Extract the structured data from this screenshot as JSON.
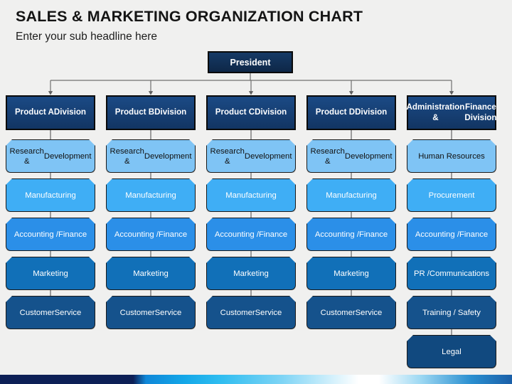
{
  "header": {
    "title": "SALES & MARKETING ORGANIZATION CHART",
    "subtitle": "Enter your sub headline here"
  },
  "colors": {
    "background": "#f0f0ef",
    "president_fill": "#13315c",
    "division_fill": "#1b4a85",
    "tier1_fill": "#7fc4f5",
    "tier2_fill": "#3faef5",
    "tier3_fill": "#2b8fe8",
    "tier4_fill": "#1170b8",
    "tier5_fill": "#15528c",
    "tier6_fill": "#11497f",
    "connector_line": "#6f6f6f",
    "text_dark": "#101010",
    "text_light": "#ffffff"
  },
  "chart_data": {
    "type": "diagram",
    "title": "SALES & MARKETING ORGANIZATION CHART",
    "subtitle": "Enter your sub headline here",
    "root": {
      "label": "President"
    },
    "branches": [
      {
        "label": "Product A Division",
        "label_lines": [
          "Product A",
          "Division"
        ],
        "units": [
          {
            "label": "Research & Development",
            "label_lines": [
              "Research &",
              "Development"
            ],
            "tier": 1
          },
          {
            "label": "Manufacturing",
            "label_lines": [
              "Manufacturing"
            ],
            "tier": 2
          },
          {
            "label": "Accounting / Finance",
            "label_lines": [
              "Accounting /",
              "Finance"
            ],
            "tier": 3
          },
          {
            "label": "Marketing",
            "label_lines": [
              "Marketing"
            ],
            "tier": 4
          },
          {
            "label": "Customer Service",
            "label_lines": [
              "Customer",
              "Service"
            ],
            "tier": 5
          }
        ]
      },
      {
        "label": "Product B Division",
        "label_lines": [
          "Product B",
          "Division"
        ],
        "units": [
          {
            "label": "Research & Development",
            "label_lines": [
              "Research &",
              "Development"
            ],
            "tier": 1
          },
          {
            "label": "Manufacturing",
            "label_lines": [
              "Manufacturing"
            ],
            "tier": 2
          },
          {
            "label": "Accounting / Finance",
            "label_lines": [
              "Accounting /",
              "Finance"
            ],
            "tier": 3
          },
          {
            "label": "Marketing",
            "label_lines": [
              "Marketing"
            ],
            "tier": 4
          },
          {
            "label": "Customer Service",
            "label_lines": [
              "Customer",
              "Service"
            ],
            "tier": 5
          }
        ]
      },
      {
        "label": "Product C Division",
        "label_lines": [
          "Product C",
          "Division"
        ],
        "units": [
          {
            "label": "Research & Development",
            "label_lines": [
              "Research &",
              "Development"
            ],
            "tier": 1
          },
          {
            "label": "Manufacturing",
            "label_lines": [
              "Manufacturing"
            ],
            "tier": 2
          },
          {
            "label": "Accounting / Finance",
            "label_lines": [
              "Accounting /",
              "Finance"
            ],
            "tier": 3
          },
          {
            "label": "Marketing",
            "label_lines": [
              "Marketing"
            ],
            "tier": 4
          },
          {
            "label": "Customer Service",
            "label_lines": [
              "Customer",
              "Service"
            ],
            "tier": 5
          }
        ]
      },
      {
        "label": "Product D Division",
        "label_lines": [
          "Product D",
          "Division"
        ],
        "units": [
          {
            "label": "Research & Development",
            "label_lines": [
              "Research &",
              "Development"
            ],
            "tier": 1
          },
          {
            "label": "Manufacturing",
            "label_lines": [
              "Manufacturing"
            ],
            "tier": 2
          },
          {
            "label": "Accounting / Finance",
            "label_lines": [
              "Accounting /",
              "Finance"
            ],
            "tier": 3
          },
          {
            "label": "Marketing",
            "label_lines": [
              "Marketing"
            ],
            "tier": 4
          },
          {
            "label": "Customer Service",
            "label_lines": [
              "Customer",
              "Service"
            ],
            "tier": 5
          }
        ]
      },
      {
        "label": "Administration & Finance Division",
        "label_lines": [
          "Administration &",
          "Finance Division"
        ],
        "units": [
          {
            "label": "Human Resources",
            "label_lines": [
              "Human Resources"
            ],
            "tier": 1
          },
          {
            "label": "Procurement",
            "label_lines": [
              "Procurement"
            ],
            "tier": 2
          },
          {
            "label": "Accounting / Finance",
            "label_lines": [
              "Accounting /",
              "Finance"
            ],
            "tier": 3
          },
          {
            "label": "PR / Communications",
            "label_lines": [
              "PR /",
              "Communications"
            ],
            "tier": 4
          },
          {
            "label": "Training / Safety",
            "label_lines": [
              "Training / Safety"
            ],
            "tier": 5
          },
          {
            "label": "Legal",
            "label_lines": [
              "Legal"
            ],
            "tier": 6
          }
        ]
      }
    ]
  }
}
